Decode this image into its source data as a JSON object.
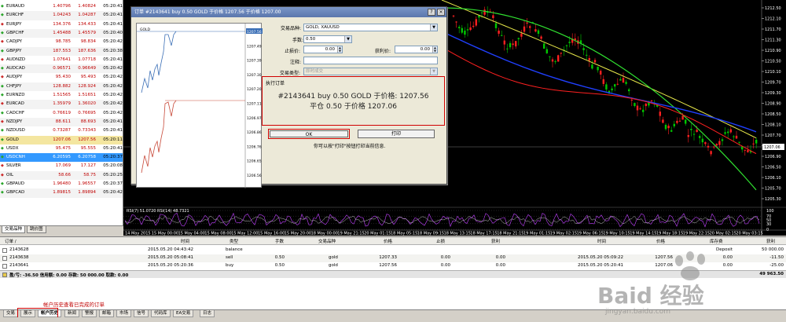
{
  "market_watch": {
    "rows": [
      {
        "symbol": "EURAUD",
        "bid": "1.40796",
        "ask": "1.40824",
        "time": "05:20:41",
        "dir": "up"
      },
      {
        "symbol": "EURCHF",
        "bid": "1.04243",
        "ask": "1.04287",
        "time": "05:20:41",
        "dir": "up"
      },
      {
        "symbol": "EURJPY",
        "bid": "134.376",
        "ask": "134.433",
        "time": "05:20:41",
        "dir": "dn"
      },
      {
        "symbol": "GBPCHF",
        "bid": "1.45488",
        "ask": "1.45579",
        "time": "05:20:40",
        "dir": "up"
      },
      {
        "symbol": "CADJPY",
        "bid": "98.785",
        "ask": "98.834",
        "time": "05:20:42",
        "dir": "dn"
      },
      {
        "symbol": "GBPJPY",
        "bid": "187.553",
        "ask": "187.636",
        "time": "05:20:38",
        "dir": "up"
      },
      {
        "symbol": "AUDNZD",
        "bid": "1.07641",
        "ask": "1.07718",
        "time": "05:20:41",
        "dir": "dn"
      },
      {
        "symbol": "AUDCAD",
        "bid": "0.96571",
        "ask": "0.96649",
        "time": "05:20:42",
        "dir": "up"
      },
      {
        "symbol": "AUDJPY",
        "bid": "95.430",
        "ask": "95.493",
        "time": "05:20:42",
        "dir": "dn"
      },
      {
        "symbol": "CHFJPY",
        "bid": "128.882",
        "ask": "128.924",
        "time": "05:20:42",
        "dir": "up"
      },
      {
        "symbol": "EURNZD",
        "bid": "1.51565",
        "ask": "1.51651",
        "time": "05:20:42",
        "dir": "up"
      },
      {
        "symbol": "EURCAD",
        "bid": "1.35979",
        "ask": "1.36020",
        "time": "05:20:42",
        "dir": "dn"
      },
      {
        "symbol": "CADCHF",
        "bid": "0.76619",
        "ask": "0.76695",
        "time": "05:20:42",
        "dir": "up"
      },
      {
        "symbol": "NZDJPY",
        "bid": "88.611",
        "ask": "88.693",
        "time": "05:20:41",
        "dir": "dn"
      },
      {
        "symbol": "NZDUSD",
        "bid": "0.73287",
        "ask": "0.73343",
        "time": "05:20:41",
        "dir": "up"
      },
      {
        "symbol": "GOLD",
        "bid": "1207.06",
        "ask": "1207.56",
        "time": "05:20:11",
        "dir": "up",
        "style": "hl"
      },
      {
        "symbol": "USDX",
        "bid": "95.475",
        "ask": "95.555",
        "time": "05:20:41",
        "dir": "up"
      },
      {
        "symbol": "USDCNH",
        "bid": "6.20595",
        "ask": "6.20758",
        "time": "05:20:37",
        "dir": "up",
        "style": "sel"
      },
      {
        "symbol": "SILVER",
        "bid": "17.069",
        "ask": "17.127",
        "time": "05:20:08",
        "dir": "dn"
      },
      {
        "symbol": "OIL",
        "bid": "58.66",
        "ask": "58.75",
        "time": "05:20:25",
        "dir": "dn"
      },
      {
        "symbol": "GBPAUD",
        "bid": "1.96480",
        "ask": "1.96557",
        "time": "05:20:37",
        "dir": "up"
      },
      {
        "symbol": "GBPCAD",
        "bid": "1.89815",
        "ask": "1.89894",
        "time": "05:20:42",
        "dir": "up"
      }
    ],
    "tabs": [
      "交易品种",
      "跳价图"
    ]
  },
  "chart": {
    "price_labels": [
      "1212.50",
      "1212.10",
      "1211.70",
      "1211.30",
      "1210.90",
      "1210.50",
      "1210.10",
      "1209.70",
      "1209.30",
      "1208.90",
      "1208.50",
      "1208.10",
      "1207.70",
      "1207.30",
      "1206.90",
      "1206.50",
      "1206.10",
      "1205.70",
      "1205.30"
    ],
    "bid_marker": "1207.06",
    "rsi_label": "RSI(7) 51.0720  RSI(14) 48.7321",
    "rsi_levels": [
      "100",
      "70",
      "50",
      "30",
      "0"
    ],
    "time_labels": [
      "14 May 2015",
      "15 May 00:00",
      "15 May 04:00",
      "15 May 08:00",
      "15 May 12:00",
      "15 May 16:00",
      "15 May 20:00",
      "18 May 00:00",
      "19 May 21:15",
      "20 May 01:15",
      "18 May 05:15",
      "18 May 09:15",
      "18 May 13:15",
      "18 May 17:15",
      "18 May 21:15",
      "19 May 01:15",
      "19 May 02:15",
      "19 May 06:15",
      "19 May 10:15",
      "19 May 14:15",
      "19 May 18:15",
      "19 May 22:15",
      "20 May 02:15",
      "20 May 03:15"
    ],
    "colors": {
      "bull": "#00c800",
      "bear": "#ff2020",
      "ma_yellow": "#e8e84a",
      "ma_green": "#30e030",
      "ma_blue": "#2040ff",
      "ma_red": "#ff2020",
      "rsi": "#c040ff"
    }
  },
  "dialog": {
    "title": "订单 #2143641 buy 0.50 GOLD 于价格 1207.56 于价格 1207.00",
    "mini_chart": {
      "symbol": "GOLD",
      "price_labels": [
        "1207.56",
        "1207.49",
        "1207.39",
        "1207.30",
        "1207.20",
        "1207.11",
        "1206.97",
        "1206.86",
        "1206.76",
        "1206.65",
        "1206.56"
      ]
    },
    "symbol_label": "交易品种:",
    "symbol_value": "GOLD, XAUUSD",
    "volume_label": "手数:",
    "volume_value": "0.50",
    "sl_label": "止损价:",
    "sl_value": "0.00",
    "tp_label": "获利价:",
    "tp_value": "0.00",
    "comment_label": "注释:",
    "comment_value": "",
    "type_label": "交易类型:",
    "type_value": "即时成交",
    "exec_title": "执行订单",
    "exec_line1": "#2143641 buy 0.50 GOLD 于价格: 1207.56",
    "exec_line2": "平仓 0.50 于价格 1207.06",
    "ok_label": "OK",
    "print_label": "打印",
    "print_note": "你可以按\"打印\"按钮打印当前信息."
  },
  "terminal": {
    "headers": [
      "订单 /",
      "时间",
      "类型",
      "手数",
      "交易品种",
      "价格",
      "止损",
      "获利",
      "时间",
      "价格",
      "库存费",
      "获利"
    ],
    "rows": [
      {
        "order": "2143628",
        "open_time": "2015.05.20 04:43:42",
        "type": "balance",
        "lots": "",
        "symbol": "",
        "price": "",
        "sl": "",
        "tp": "",
        "close_time": "",
        "close_price": "",
        "swap": "Deposit",
        "profit": "50 000.00"
      },
      {
        "order": "2143638",
        "open_time": "2015.05.20 05:08:41",
        "type": "sell",
        "lots": "0.50",
        "symbol": "gold",
        "price": "1207.33",
        "sl": "0.00",
        "tp": "0.00",
        "close_time": "2015.05.20 05:09:22",
        "close_price": "1207.56",
        "swap": "0.00",
        "profit": "-11.50"
      },
      {
        "order": "2143641",
        "open_time": "2015.05.20 05:20:36",
        "type": "buy",
        "lots": "0.50",
        "symbol": "gold",
        "price": "1207.56",
        "sl": "0.00",
        "tp": "0.00",
        "close_time": "2015.05.20 05:20:41",
        "close_price": "1207.06",
        "swap": "0.00",
        "profit": "-25.00"
      }
    ],
    "total_label": "盈/亏: -36.50  信用额: 0.00  存款: 50 000.00  取款: 0.00",
    "total_value": "49 963.50",
    "history_note": "帐户历史查看已完成的订单"
  },
  "bottom_tabs": [
    "交易",
    "展示",
    "帐户历史",
    "新闻",
    "警报",
    "邮箱",
    "市场",
    "信号",
    "代码库",
    "EA交易",
    "日志"
  ],
  "watermark": {
    "text": "Baid 经验",
    "url": "jingyan.baidu.com"
  }
}
